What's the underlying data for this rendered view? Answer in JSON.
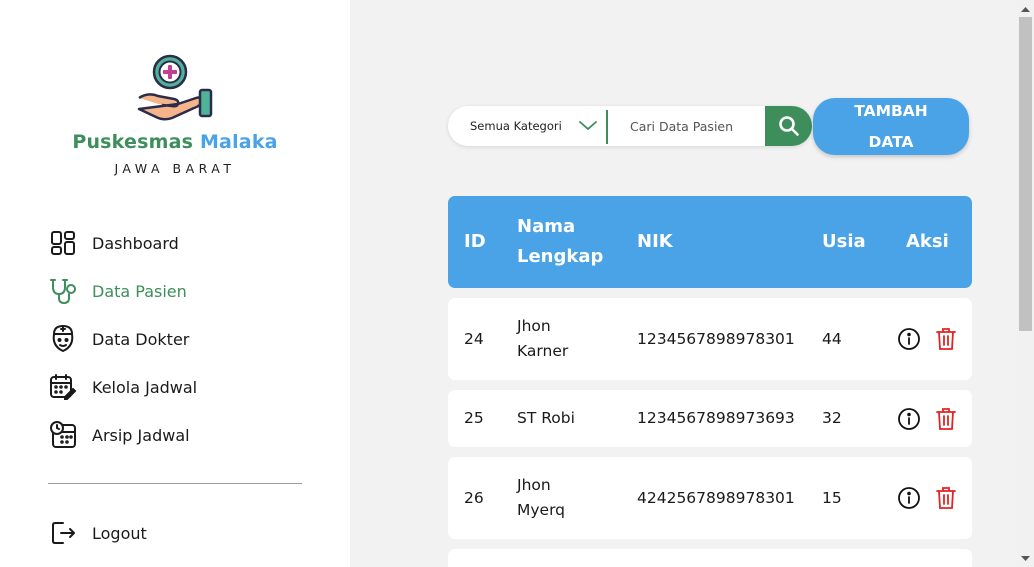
{
  "brand": {
    "name_part1": "Puskesmas",
    "name_part2": "Malaka",
    "region": "JAWA BARAT",
    "logo_icon": "hand-medical-cross-icon"
  },
  "sidebar": {
    "items": [
      {
        "label": "Dashboard",
        "icon": "dashboard-grid-icon",
        "active": false
      },
      {
        "label": "Data Pasien",
        "icon": "stethoscope-icon",
        "active": true
      },
      {
        "label": "Data Dokter",
        "icon": "doctor-icon",
        "active": false
      },
      {
        "label": "Kelola Jadwal",
        "icon": "calendar-edit-icon",
        "active": false
      },
      {
        "label": "Arsip Jadwal",
        "icon": "calendar-clock-icon",
        "active": false
      }
    ],
    "logout_label": "Logout"
  },
  "search": {
    "category_selected": "Semua Kategori",
    "placeholder": "Cari Data Pasien",
    "value": ""
  },
  "actions": {
    "add_line1": "TAMBAH",
    "add_line2": "DATA"
  },
  "table": {
    "headers": {
      "id": "ID",
      "name_line1": "Nama",
      "name_line2": "Lengkap",
      "nik": "NIK",
      "age": "Usia",
      "action": "Aksi"
    },
    "rows": [
      {
        "id": "24",
        "name_line1": "Jhon",
        "name_line2": "Karner",
        "nik": "1234567898978301",
        "age": "44"
      },
      {
        "id": "25",
        "name_line1": "ST Robi",
        "name_line2": "",
        "nik": "1234567898973693",
        "age": "32"
      },
      {
        "id": "26",
        "name_line1": "Jhon",
        "name_line2": "Myerq",
        "nik": "4242567898978301",
        "age": "15"
      }
    ]
  },
  "colors": {
    "green": "#3e8e5c",
    "blue": "#4aa3e6",
    "delete_red": "#e02424",
    "background": "#f2f2f2"
  }
}
